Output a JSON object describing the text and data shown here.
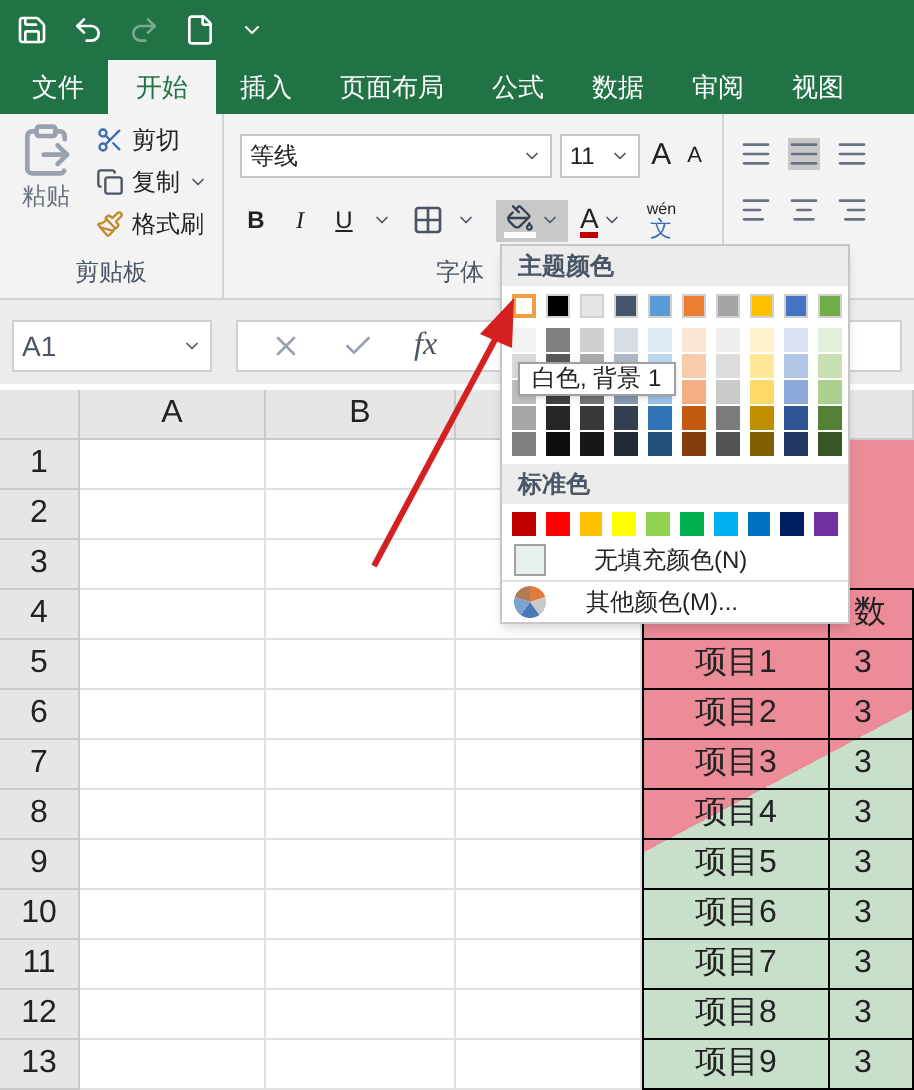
{
  "ribbon_tabs": [
    {
      "label": "文件",
      "selected": false
    },
    {
      "label": "开始",
      "selected": true
    },
    {
      "label": "插入",
      "selected": false
    },
    {
      "label": "页面布局",
      "selected": false
    },
    {
      "label": "公式",
      "selected": false
    },
    {
      "label": "数据",
      "selected": false
    },
    {
      "label": "审阅",
      "selected": false
    },
    {
      "label": "视图",
      "selected": false
    }
  ],
  "clipboard": {
    "paste": "粘贴",
    "cut": "剪切",
    "copy": "复制",
    "format_painter": "格式刷",
    "group_label": "剪贴板"
  },
  "font": {
    "name": "等线",
    "size": "11",
    "grow": "A",
    "shrink": "A",
    "bold": "B",
    "italic": "I",
    "underline": "U",
    "font_color": "A",
    "phonetic_top": "wén",
    "phonetic_bottom": "文",
    "group_label": "字体"
  },
  "formula_bar": {
    "name_box": "A1",
    "fx": "fx"
  },
  "sheet": {
    "columns": [
      "A",
      "B"
    ],
    "rows": [
      {
        "number": "1"
      },
      {
        "number": "2"
      },
      {
        "number": "3"
      },
      {
        "number": "4",
        "col_e": "数"
      },
      {
        "number": "5",
        "col_d": "项目1",
        "col_e": "3"
      },
      {
        "number": "6",
        "col_d": "项目2",
        "col_e": "3"
      },
      {
        "number": "7",
        "col_d": "项目3",
        "col_e": "3"
      },
      {
        "number": "8",
        "col_d": "项目4",
        "col_e": "3"
      },
      {
        "number": "9",
        "col_d": "项目5",
        "col_e": "3"
      },
      {
        "number": "10",
        "col_d": "项目6",
        "col_e": "3"
      },
      {
        "number": "11",
        "col_d": "项目7",
        "col_e": "3"
      },
      {
        "number": "12",
        "col_d": "项目8",
        "col_e": "3"
      },
      {
        "number": "13",
        "col_d": "项目9",
        "col_e": "3"
      }
    ]
  },
  "fill_menu": {
    "theme_heading": "主题颜色",
    "theme_colors": [
      {
        "color": "#ffffff",
        "selected": true,
        "shades": [
          {
            "color": "#f2f2f2"
          },
          {
            "color": "#d9d9d9"
          },
          {
            "color": "#bfbfbf"
          },
          {
            "color": "#a6a6a6"
          },
          {
            "color": "#808080"
          }
        ]
      },
      {
        "color": "#000000",
        "selected": false,
        "shades": [
          {
            "color": "#808080"
          },
          {
            "color": "#595959"
          },
          {
            "color": "#404040"
          },
          {
            "color": "#262626"
          },
          {
            "color": "#0d0d0d"
          }
        ]
      },
      {
        "color": "#e7e6e6",
        "selected": false,
        "shades": [
          {
            "color": "#d0cece"
          },
          {
            "color": "#aeaaaa"
          },
          {
            "color": "#757171"
          },
          {
            "color": "#3b3838"
          },
          {
            "color": "#171616"
          }
        ]
      },
      {
        "color": "#44546a",
        "selected": false,
        "shades": [
          {
            "color": "#d6dce4"
          },
          {
            "color": "#adb9ca"
          },
          {
            "color": "#8497b0"
          },
          {
            "color": "#333f4f"
          },
          {
            "color": "#222a35"
          }
        ]
      },
      {
        "color": "#5b9bd5",
        "selected": false,
        "shades": [
          {
            "color": "#ddebf7"
          },
          {
            "color": "#bdd7ee"
          },
          {
            "color": "#9bc2e6"
          },
          {
            "color": "#2f75b5"
          },
          {
            "color": "#1f4e78"
          }
        ]
      },
      {
        "color": "#ed7d31",
        "selected": false,
        "shades": [
          {
            "color": "#fce4d6"
          },
          {
            "color": "#f8cbad"
          },
          {
            "color": "#f4b084"
          },
          {
            "color": "#c65911"
          },
          {
            "color": "#833c0c"
          }
        ]
      },
      {
        "color": "#a5a5a5",
        "selected": false,
        "shades": [
          {
            "color": "#ededed"
          },
          {
            "color": "#dbdbdb"
          },
          {
            "color": "#c9c9c9"
          },
          {
            "color": "#7b7b7b"
          },
          {
            "color": "#525252"
          }
        ]
      },
      {
        "color": "#ffc000",
        "selected": false,
        "shades": [
          {
            "color": "#fff2cc"
          },
          {
            "color": "#ffe699"
          },
          {
            "color": "#ffd966"
          },
          {
            "color": "#bf8f00"
          },
          {
            "color": "#806000"
          }
        ]
      },
      {
        "color": "#4472c4",
        "selected": false,
        "shades": [
          {
            "color": "#d9e1f2"
          },
          {
            "color": "#b4c6e7"
          },
          {
            "color": "#8ea9db"
          },
          {
            "color": "#305496"
          },
          {
            "color": "#203764"
          }
        ]
      },
      {
        "color": "#70ad47",
        "selected": false,
        "shades": [
          {
            "color": "#e2efda"
          },
          {
            "color": "#c6e0b4"
          },
          {
            "color": "#a9d08e"
          },
          {
            "color": "#548235"
          },
          {
            "color": "#375623"
          }
        ]
      }
    ],
    "tooltip": "白色, 背景 1",
    "standard_heading": "标准色",
    "standard_colors": [
      {
        "color": "#c00000"
      },
      {
        "color": "#ff0000"
      },
      {
        "color": "#ffc000"
      },
      {
        "color": "#ffff00"
      },
      {
        "color": "#92d050"
      },
      {
        "color": "#00b050"
      },
      {
        "color": "#00b0f0"
      },
      {
        "color": "#0070c0"
      },
      {
        "color": "#002060"
      },
      {
        "color": "#7030a0"
      }
    ],
    "no_fill": "无填充颜色(N)",
    "more_colors": "其他颜色(M)..."
  }
}
